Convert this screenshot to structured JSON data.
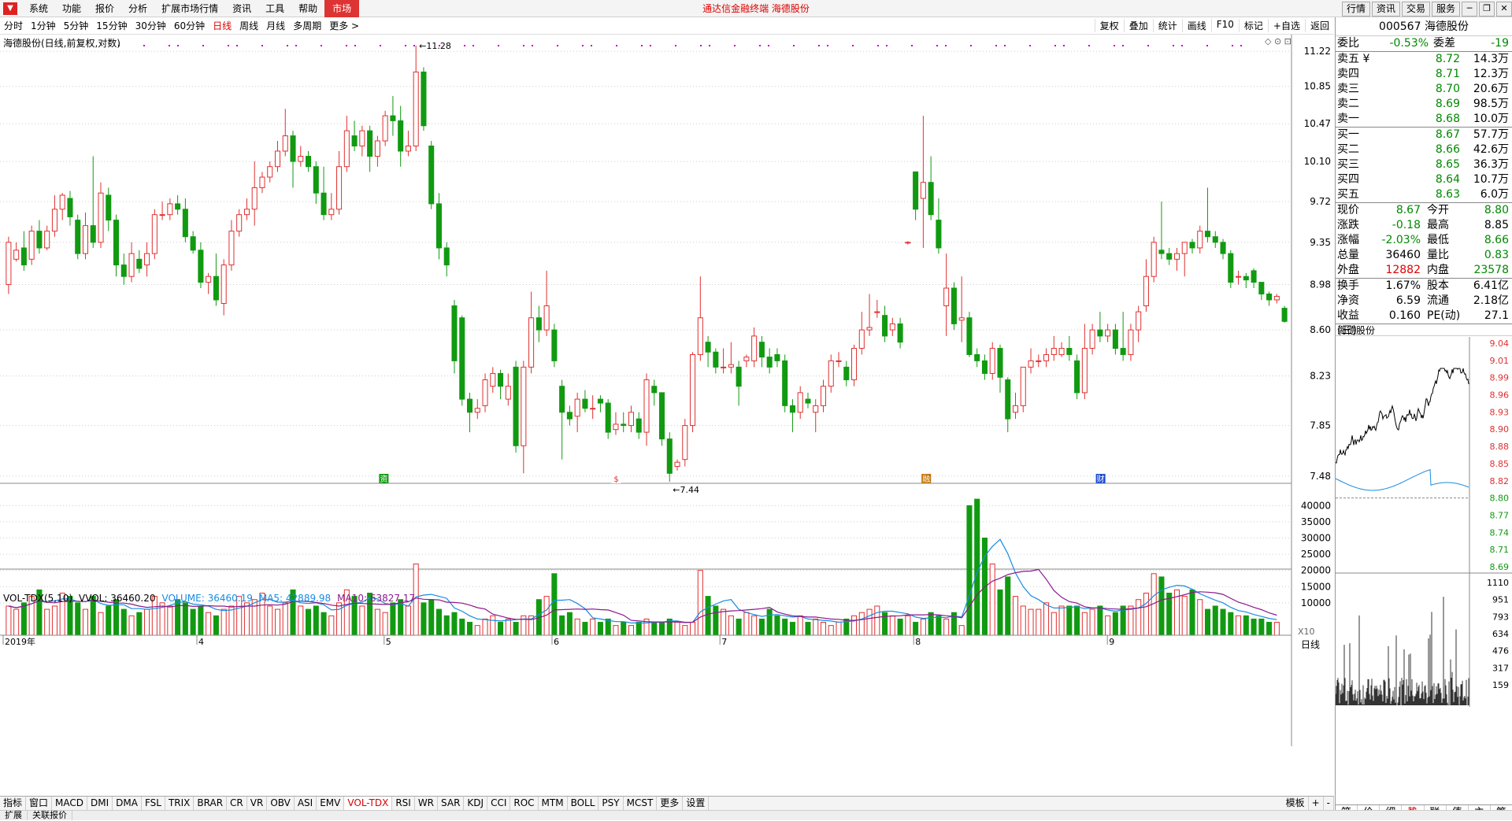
{
  "menubar": {
    "items": [
      "系统",
      "功能",
      "报价",
      "分析",
      "扩展市场行情",
      "资讯",
      "工具",
      "帮助",
      "市场"
    ],
    "title": "通达信金融终端  海德股份",
    "right_buttons": [
      "行情",
      "资讯",
      "交易",
      "服务"
    ],
    "window_buttons": [
      "─",
      "❐",
      "✕"
    ]
  },
  "toolbar": {
    "periods": [
      "分时",
      "1分钟",
      "5分钟",
      "15分钟",
      "30分钟",
      "60分钟",
      "日线",
      "周线",
      "月线",
      "多周期",
      "更多 >"
    ],
    "selected": "日线",
    "right": [
      "复权",
      "叠加",
      "统计",
      "画线",
      "F10",
      "标记",
      "+自选",
      "返回"
    ]
  },
  "chart": {
    "title": "海德股份(日线,前复权,对数)",
    "icons": "◇ ⊙ ⊡",
    "y_ticks": [
      "11.22",
      "10.85",
      "10.47",
      "10.10",
      "9.72",
      "9.35",
      "8.98",
      "8.60",
      "8.23",
      "7.85",
      "7.48"
    ],
    "high_label": "11.28",
    "low_label": "7.44",
    "x_labels": [
      "2019年",
      "4",
      "5",
      "6",
      "7",
      "8",
      "9"
    ],
    "markers": [
      "资",
      "$",
      "融",
      "财"
    ],
    "vol_legend": {
      "name": "VOL-TDX(5,10)",
      "vvol": "VVOL: 36460.20",
      "volume": "VOLUME: 36460.19",
      "ma5": "MA5: 42889.98",
      "ma10": "MA10: 63827.17"
    },
    "vol_ticks": [
      "40000",
      "35000",
      "30000",
      "25000",
      "20000",
      "15000",
      "10000"
    ],
    "vol_unit": "X10",
    "period_box": "日线"
  },
  "chart_data": {
    "type": "candlestick",
    "title": "海德股份(日线,前复权,对数)",
    "ylim": [
      7.44,
      11.28
    ],
    "candles": [
      [
        8.98,
        9.35,
        8.9,
        9.4
      ],
      [
        9.2,
        9.28,
        9.18,
        9.35
      ],
      [
        9.3,
        9.15,
        9.1,
        9.45
      ],
      [
        9.2,
        9.45,
        9.15,
        9.5
      ],
      [
        9.45,
        9.3,
        9.25,
        9.55
      ],
      [
        9.3,
        9.45,
        9.28,
        9.5
      ],
      [
        9.45,
        9.65,
        9.4,
        9.78
      ],
      [
        9.65,
        9.78,
        9.55,
        9.8
      ],
      [
        9.75,
        9.58,
        9.5,
        9.82
      ],
      [
        9.55,
        9.25,
        9.2,
        9.6
      ],
      [
        9.25,
        9.5,
        9.2,
        9.62
      ],
      [
        9.5,
        9.35,
        9.3,
        10.15
      ],
      [
        9.35,
        9.8,
        9.3,
        9.9
      ],
      [
        9.78,
        9.55,
        9.45,
        9.85
      ],
      [
        9.55,
        9.15,
        9.05,
        9.6
      ],
      [
        9.15,
        9.05,
        8.98,
        9.25
      ],
      [
        9.05,
        9.25,
        9.0,
        9.35
      ],
      [
        9.2,
        9.12,
        9.08,
        9.28
      ],
      [
        9.15,
        9.25,
        9.05,
        9.35
      ],
      [
        9.25,
        9.6,
        9.2,
        9.65
      ],
      [
        9.6,
        9.6,
        9.55,
        9.72
      ],
      [
        9.6,
        9.7,
        9.55,
        9.75
      ],
      [
        9.7,
        9.65,
        9.6,
        9.78
      ],
      [
        9.65,
        9.4,
        9.35,
        9.75
      ],
      [
        9.4,
        9.28,
        9.25,
        9.45
      ],
      [
        9.28,
        9.0,
        8.95,
        9.35
      ],
      [
        9.0,
        9.05,
        8.9,
        9.08
      ],
      [
        9.05,
        8.85,
        8.8,
        9.25
      ],
      [
        8.82,
        9.15,
        8.72,
        9.2
      ],
      [
        9.15,
        9.45,
        9.1,
        9.55
      ],
      [
        9.45,
        9.6,
        9.4,
        9.65
      ],
      [
        9.6,
        9.65,
        9.55,
        9.75
      ],
      [
        9.65,
        9.85,
        9.5,
        10.1
      ],
      [
        9.85,
        9.95,
        9.8,
        10.0
      ],
      [
        9.95,
        10.05,
        9.9,
        10.1
      ],
      [
        10.05,
        10.2,
        10.0,
        10.3
      ],
      [
        10.2,
        10.35,
        10.15,
        10.62
      ],
      [
        10.35,
        10.1,
        9.85,
        10.4
      ],
      [
        10.1,
        10.15,
        10.05,
        10.25
      ],
      [
        10.15,
        10.05,
        10.0,
        10.2
      ],
      [
        10.05,
        9.8,
        9.7,
        10.1
      ],
      [
        9.8,
        9.6,
        9.55,
        10.05
      ],
      [
        9.6,
        9.65,
        9.55,
        9.8
      ],
      [
        9.65,
        10.05,
        9.6,
        10.2
      ],
      [
        10.05,
        10.4,
        10.0,
        10.55
      ],
      [
        10.35,
        10.25,
        10.2,
        10.5
      ],
      [
        10.25,
        10.4,
        10.15,
        10.45
      ],
      [
        10.4,
        10.15,
        10.0,
        10.45
      ],
      [
        10.15,
        10.3,
        10.05,
        10.35
      ],
      [
        10.3,
        10.55,
        10.25,
        10.6
      ],
      [
        10.55,
        10.5,
        10.35,
        10.75
      ],
      [
        10.5,
        10.2,
        10.05,
        10.65
      ],
      [
        10.2,
        10.25,
        10.15,
        10.4
      ],
      [
        10.25,
        11.0,
        10.2,
        11.28
      ],
      [
        11.0,
        10.45,
        10.4,
        11.05
      ],
      [
        10.25,
        9.7,
        9.65,
        10.3
      ],
      [
        9.7,
        9.3,
        9.2,
        9.8
      ],
      [
        9.3,
        9.15,
        9.05,
        9.35
      ],
      [
        8.8,
        8.35,
        8.25,
        8.85
      ],
      [
        8.7,
        8.05,
        8.0,
        8.72
      ],
      [
        8.05,
        7.95,
        7.8,
        8.1
      ],
      [
        7.95,
        7.98,
        7.9,
        8.05
      ],
      [
        8.0,
        8.2,
        7.95,
        8.25
      ],
      [
        8.15,
        8.25,
        8.1,
        8.3
      ],
      [
        8.25,
        8.15,
        8.05,
        8.28
      ],
      [
        8.05,
        8.15,
        8.0,
        8.25
      ],
      [
        8.3,
        7.7,
        7.65,
        8.35
      ],
      [
        7.7,
        8.3,
        7.5,
        8.35
      ],
      [
        8.3,
        8.7,
        8.25,
        8.92
      ],
      [
        8.7,
        8.6,
        8.5,
        8.8
      ],
      [
        8.6,
        8.8,
        8.55,
        9.1
      ],
      [
        8.6,
        8.35,
        8.3,
        8.65
      ],
      [
        8.15,
        7.95,
        7.6,
        8.2
      ],
      [
        7.95,
        7.9,
        7.85,
        8.0
      ],
      [
        7.92,
        8.05,
        7.8,
        8.1
      ],
      [
        8.05,
        7.98,
        7.95,
        8.12
      ],
      [
        7.98,
        7.98,
        7.9,
        8.08
      ],
      [
        8.05,
        8.02,
        7.95,
        8.08
      ],
      [
        8.02,
        7.8,
        7.75,
        8.05
      ],
      [
        7.82,
        7.86,
        7.78,
        7.95
      ],
      [
        7.86,
        7.85,
        7.8,
        7.95
      ],
      [
        7.85,
        7.95,
        7.8,
        8.0
      ],
      [
        7.9,
        7.8,
        7.75,
        7.95
      ],
      [
        7.8,
        8.2,
        7.7,
        8.25
      ],
      [
        8.15,
        8.1,
        8.0,
        8.2
      ],
      [
        8.1,
        7.75,
        7.7,
        8.1
      ],
      [
        7.75,
        7.5,
        7.44,
        7.8
      ],
      [
        7.55,
        7.58,
        7.52,
        7.6
      ],
      [
        7.6,
        7.85,
        7.55,
        7.9
      ],
      [
        7.85,
        8.4,
        7.8,
        8.42
      ],
      [
        8.4,
        8.7,
        8.35,
        9.05
      ],
      [
        8.5,
        8.42,
        8.3,
        8.55
      ],
      [
        8.42,
        8.3,
        8.25,
        8.45
      ],
      [
        8.3,
        8.3,
        8.25,
        8.45
      ],
      [
        8.3,
        8.32,
        8.25,
        8.5
      ],
      [
        8.3,
        8.15,
        8.0,
        8.35
      ],
      [
        8.35,
        8.38,
        8.3,
        8.4
      ],
      [
        8.35,
        8.55,
        8.3,
        8.62
      ],
      [
        8.5,
        8.38,
        8.3,
        8.55
      ],
      [
        8.38,
        8.3,
        8.25,
        8.45
      ],
      [
        8.4,
        8.35,
        8.3,
        8.45
      ],
      [
        8.35,
        8.0,
        7.95,
        8.4
      ],
      [
        8.0,
        7.95,
        7.8,
        8.05
      ],
      [
        7.95,
        8.1,
        7.9,
        8.15
      ],
      [
        8.05,
        8.02,
        7.98,
        8.1
      ],
      [
        7.95,
        8.0,
        7.8,
        8.05
      ],
      [
        8.0,
        8.15,
        7.95,
        8.2
      ],
      [
        8.15,
        8.35,
        8.1,
        8.4
      ],
      [
        8.35,
        8.35,
        8.3,
        8.42
      ],
      [
        8.3,
        8.2,
        8.15,
        8.35
      ],
      [
        8.2,
        8.45,
        8.15,
        8.48
      ],
      [
        8.45,
        8.6,
        8.4,
        8.75
      ],
      [
        8.6,
        8.62,
        8.55,
        8.9
      ],
      [
        8.75,
        8.75,
        8.7,
        8.85
      ],
      [
        8.72,
        8.55,
        8.5,
        8.8
      ],
      [
        8.6,
        8.65,
        8.55,
        8.7
      ],
      [
        8.65,
        8.5,
        8.45,
        8.7
      ],
      [
        9.35,
        9.35,
        9.33,
        9.36
      ],
      [
        10.0,
        9.65,
        9.55,
        10.0
      ],
      [
        9.75,
        9.9,
        9.3,
        10.55
      ],
      [
        9.9,
        9.6,
        9.55,
        10.15
      ],
      [
        9.55,
        9.3,
        9.25,
        9.75
      ],
      [
        8.8,
        8.95,
        8.55,
        9.25
      ],
      [
        8.95,
        8.65,
        8.6,
        9.0
      ],
      [
        8.68,
        8.7,
        8.5,
        9.05
      ],
      [
        8.7,
        8.4,
        8.38,
        8.75
      ],
      [
        8.4,
        8.35,
        8.3,
        8.45
      ],
      [
        8.35,
        8.25,
        8.2,
        8.4
      ],
      [
        8.25,
        8.45,
        8.2,
        8.5
      ],
      [
        8.45,
        8.22,
        8.1,
        8.48
      ],
      [
        8.2,
        7.9,
        7.8,
        8.22
      ],
      [
        7.95,
        8.0,
        7.9,
        8.1
      ],
      [
        8.0,
        8.3,
        7.95,
        8.3
      ],
      [
        8.3,
        8.35,
        8.25,
        8.45
      ],
      [
        8.35,
        8.35,
        8.3,
        8.4
      ],
      [
        8.35,
        8.4,
        8.3,
        8.45
      ],
      [
        8.4,
        8.45,
        8.35,
        8.55
      ],
      [
        8.4,
        8.45,
        8.38,
        8.5
      ],
      [
        8.45,
        8.4,
        8.35,
        8.55
      ],
      [
        8.35,
        8.1,
        8.05,
        8.4
      ],
      [
        8.1,
        8.45,
        8.05,
        8.65
      ],
      [
        8.45,
        8.6,
        8.4,
        8.65
      ],
      [
        8.6,
        8.55,
        8.5,
        8.75
      ],
      [
        8.55,
        8.6,
        8.5,
        8.65
      ],
      [
        8.6,
        8.45,
        8.4,
        8.65
      ],
      [
        8.45,
        8.4,
        8.35,
        8.75
      ],
      [
        8.4,
        8.6,
        8.35,
        8.65
      ],
      [
        8.6,
        8.75,
        8.5,
        8.8
      ],
      [
        8.8,
        9.05,
        8.75,
        9.2
      ],
      [
        9.05,
        9.35,
        9.0,
        9.4
      ],
      [
        9.28,
        9.25,
        9.2,
        9.72
      ],
      [
        9.25,
        9.2,
        9.15,
        9.3
      ],
      [
        9.2,
        9.25,
        9.1,
        9.3
      ],
      [
        9.25,
        9.35,
        9.05,
        9.35
      ],
      [
        9.35,
        9.3,
        9.25,
        9.38
      ],
      [
        9.3,
        9.45,
        9.25,
        9.5
      ],
      [
        9.45,
        9.4,
        9.35,
        9.85
      ],
      [
        9.4,
        9.35,
        9.3,
        9.45
      ],
      [
        9.35,
        9.25,
        9.2,
        9.38
      ],
      [
        9.25,
        9.0,
        8.95,
        9.28
      ],
      [
        9.05,
        9.05,
        8.98,
        9.1
      ],
      [
        9.05,
        9.02,
        8.95,
        9.08
      ],
      [
        9.1,
        9.0,
        8.95,
        9.12
      ],
      [
        9.0,
        8.9,
        8.85,
        9.0
      ],
      [
        8.9,
        8.85,
        8.8,
        8.92
      ],
      [
        8.85,
        8.88,
        8.82,
        8.9
      ],
      [
        8.78,
        8.67,
        8.66,
        8.8
      ]
    ],
    "volume_ticks": [
      10000,
      15000,
      20000,
      25000,
      30000,
      35000,
      40000
    ],
    "volume_legend": {
      "VOLUME": 36460.19,
      "MA5": 42889.98,
      "MA10": 63827.17
    },
    "volumes": [
      9,
      8,
      10,
      12,
      14,
      8,
      9,
      13,
      12,
      10,
      8,
      12,
      7,
      9,
      11,
      8,
      6,
      7,
      8,
      12,
      10,
      9,
      11,
      10,
      8,
      9,
      7,
      6,
      8,
      9,
      12,
      10,
      11,
      13,
      9,
      8,
      10,
      14,
      9,
      8,
      9,
      7,
      6,
      10,
      14,
      12,
      9,
      13,
      8,
      7,
      10,
      11,
      9,
      22,
      10,
      11,
      8,
      6,
      7,
      5,
      4,
      3,
      5,
      6,
      4,
      5,
      4,
      6,
      6,
      11,
      12,
      19,
      6,
      7,
      5,
      4,
      5,
      4,
      5,
      3,
      4,
      3,
      4,
      5,
      4,
      4,
      5,
      4,
      3,
      4,
      20,
      12,
      9,
      8,
      6,
      5,
      7,
      6,
      5,
      8,
      6,
      5,
      4,
      6,
      4,
      5,
      4,
      3,
      4,
      5,
      6,
      7,
      8,
      9,
      7,
      6,
      5,
      6,
      4,
      5,
      7,
      6,
      5,
      7,
      3,
      40,
      42,
      30,
      22,
      14,
      18,
      12,
      9,
      8,
      8,
      10,
      7,
      9,
      9,
      9,
      7,
      8,
      9,
      6,
      7,
      9,
      9,
      11,
      13,
      19,
      18,
      13,
      14,
      12,
      14,
      11,
      8,
      9,
      8,
      7,
      6,
      6,
      5,
      5,
      4,
      4
    ]
  },
  "right": {
    "title": "000567 海德股份",
    "weibi": {
      "label": "委比",
      "value": "-0.53%",
      "label2": "委差",
      "value2": "-19"
    },
    "sell": [
      {
        "label": "卖五 ¥",
        "price": "8.72",
        "vol": "14.3万"
      },
      {
        "label": "卖四",
        "price": "8.71",
        "vol": "12.3万"
      },
      {
        "label": "卖三",
        "price": "8.70",
        "vol": "20.6万"
      },
      {
        "label": "卖二",
        "price": "8.69",
        "vol": "98.5万"
      },
      {
        "label": "卖一",
        "price": "8.68",
        "vol": "10.0万"
      }
    ],
    "buy": [
      {
        "label": "买一",
        "price": "8.67",
        "vol": "57.7万"
      },
      {
        "label": "买二",
        "price": "8.66",
        "vol": "42.6万"
      },
      {
        "label": "买三",
        "price": "8.65",
        "vol": "36.3万"
      },
      {
        "label": "买四",
        "price": "8.64",
        "vol": "10.7万"
      },
      {
        "label": "买五",
        "price": "8.63",
        "vol": "6.0万"
      }
    ],
    "stats1": [
      {
        "l1": "现价",
        "v1": "8.67",
        "c1": "dn",
        "l2": "今开",
        "v2": "8.80",
        "c2": "dn"
      },
      {
        "l1": "涨跌",
        "v1": "-0.18",
        "c1": "dn",
        "l2": "最高",
        "v2": "8.85",
        "c2": "bk"
      },
      {
        "l1": "涨幅",
        "v1": "-2.03%",
        "c1": "dn",
        "l2": "最低",
        "v2": "8.66",
        "c2": "dn"
      },
      {
        "l1": "总量",
        "v1": "36460",
        "c1": "bk",
        "l2": "量比",
        "v2": "0.83",
        "c2": "dn"
      },
      {
        "l1": "外盘",
        "v1": "12882",
        "c1": "up",
        "l2": "内盘",
        "v2": "23578",
        "c2": "dn"
      }
    ],
    "stats2": [
      {
        "l1": "换手",
        "v1": "1.67%",
        "l2": "股本",
        "v2": "6.41亿"
      },
      {
        "l1": "净资",
        "v1": "6.59",
        "l2": "流通",
        "v2": "2.18亿"
      },
      {
        "l1": "收益(三)",
        "v1": "0.160",
        "l2": "PE(动)",
        "v2": "27.1"
      }
    ],
    "mini_title": "海德股份",
    "mini_prices": [
      "9.04",
      "9.01",
      "8.99",
      "8.96",
      "8.93",
      "8.90",
      "8.88",
      "8.85",
      "8.82",
      "8.80",
      "8.77",
      "8.74",
      "8.71",
      "8.69"
    ],
    "mini_vols": [
      "1110",
      "951",
      "793",
      "634",
      "476",
      "317",
      "159"
    ],
    "tabs": [
      "笔",
      "价",
      "细",
      "势",
      "联",
      "值",
      "主",
      "筹"
    ],
    "tab_selected": "势"
  },
  "bottom": {
    "indicators": [
      "指标",
      "窗口",
      "MACD",
      "DMI",
      "DMA",
      "FSL",
      "TRIX",
      "BRAR",
      "CR",
      "VR",
      "OBV",
      "ASI",
      "EMV",
      "VOL-TDX",
      "RSI",
      "WR",
      "SAR",
      "KDJ",
      "CCI",
      "ROC",
      "MTM",
      "BOLL",
      "PSY",
      "MCST",
      "更多",
      "设置"
    ],
    "selected": "VOL-TDX",
    "right": [
      "模板",
      "+",
      "-"
    ]
  },
  "status": {
    "items": [
      "扩展",
      "关联报价"
    ]
  },
  "colors": {
    "up": "#e03030",
    "down": "#119a11",
    "ma5": "#1a8be0",
    "ma10": "#8b1a8b",
    "accent": "#d00000"
  }
}
